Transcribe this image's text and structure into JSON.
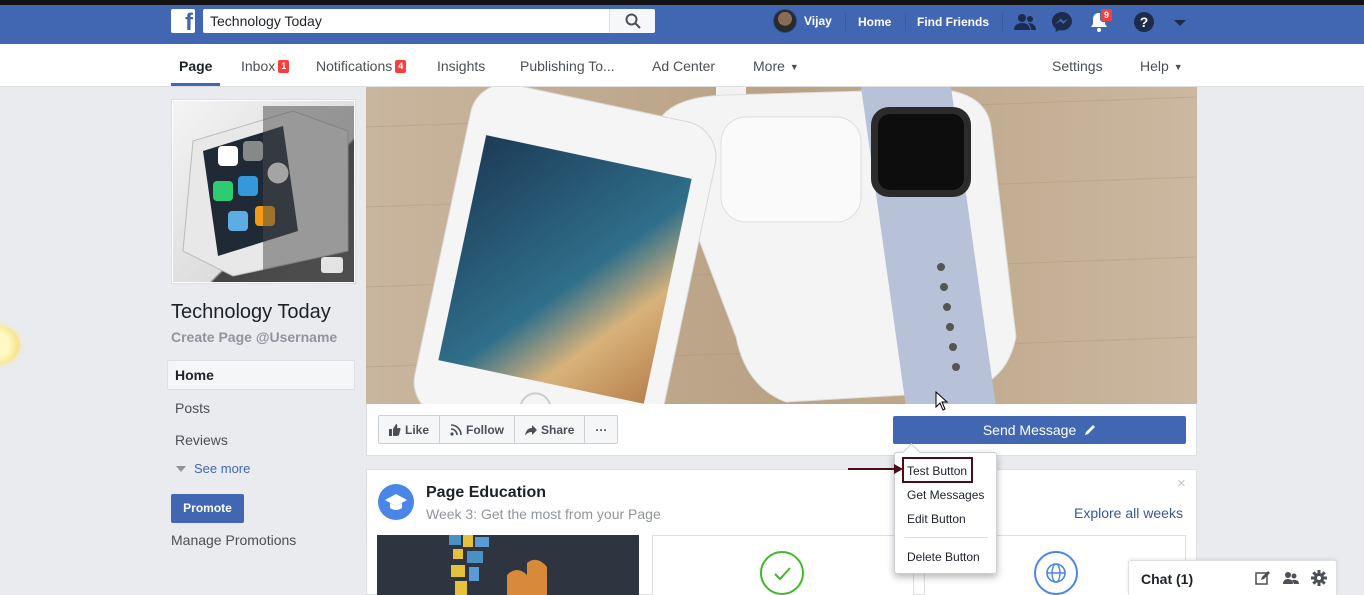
{
  "topbar": {
    "logo_letter": "f",
    "search_value": "Technology Today",
    "user_name": "Vijay",
    "home_label": "Home",
    "find_friends_label": "Find Friends",
    "notifications_badge": "9",
    "brand_color": "#4267b2"
  },
  "pagenav": {
    "tabs": [
      {
        "label": "Page"
      },
      {
        "label": "Inbox",
        "badge": "1"
      },
      {
        "label": "Notifications",
        "badge": "4"
      },
      {
        "label": "Insights"
      },
      {
        "label": "Publishing To..."
      },
      {
        "label": "Ad Center"
      },
      {
        "label": "More"
      }
    ],
    "settings_label": "Settings",
    "help_label": "Help"
  },
  "left": {
    "page_name": "Technology Today",
    "username_cta": "Create Page @Username",
    "nav": [
      "Home",
      "Posts",
      "Reviews"
    ],
    "see_more": "See more",
    "promote": "Promote",
    "manage_promotions": "Manage Promotions"
  },
  "actions": {
    "like": "Like",
    "follow": "Follow",
    "share": "Share",
    "more": "···",
    "send_message": "Send Message"
  },
  "dropdown": {
    "items": [
      "Test Button",
      "Get Messages",
      "Edit Button",
      "Delete Button"
    ]
  },
  "education": {
    "title": "Page Education",
    "subtitle": "Week 3: Get the most from your Page",
    "explore": "Explore all weeks",
    "close": "×"
  },
  "chat": {
    "label": "Chat (1)"
  }
}
